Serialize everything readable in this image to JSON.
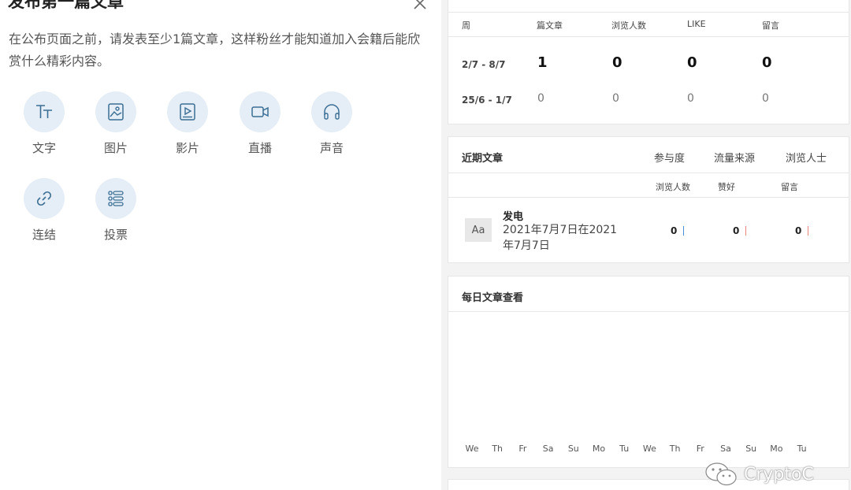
{
  "modal": {
    "title": "发布第一篇文章",
    "description": "在公布页面之前，请发表至少1篇文章，这样粉丝才能知道加入会籍后能欣赏什么精彩内容。",
    "post_types": [
      {
        "label": "文字",
        "icon": "text-icon"
      },
      {
        "label": "图片",
        "icon": "image-icon"
      },
      {
        "label": "影片",
        "icon": "video-icon"
      },
      {
        "label": "直播",
        "icon": "livestream-icon"
      },
      {
        "label": "声音",
        "icon": "audio-icon"
      },
      {
        "label": "连结",
        "icon": "link-icon"
      },
      {
        "label": "投票",
        "icon": "poll-icon"
      }
    ]
  },
  "weekly_stats": {
    "headers": {
      "week": "周",
      "posts": "篇文章",
      "views": "浏览人数",
      "likes": "LIKE",
      "comments": "留言"
    },
    "rows": [
      {
        "week": "2/7 - 8/7",
        "posts": "1",
        "views": "0",
        "likes": "0",
        "comments": "0"
      },
      {
        "week": "25/6 - 1/7",
        "posts": "0",
        "views": "0",
        "likes": "0",
        "comments": "0"
      }
    ]
  },
  "recent_posts": {
    "title": "近期文章",
    "columns": [
      "参与度",
      "流量来源",
      "浏览人士"
    ],
    "sub_headers": [
      "浏览人数",
      "赞好",
      "留言"
    ],
    "thumb": "Aa",
    "article": {
      "title": "发电",
      "date": "2021年7月7日在2021年7月7日",
      "views": "0",
      "likes": "0",
      "comments": "0"
    },
    "bar_colors": {
      "views": "#4a90d9",
      "likes": "#e8857a",
      "comments": "#e8857a"
    }
  },
  "daily_views": {
    "title": "每日文章查看",
    "days": [
      "We",
      "Th",
      "Fr",
      "Sa",
      "Su",
      "Mo",
      "Tu",
      "We",
      "Th",
      "Fr",
      "Sa",
      "Su",
      "Mo",
      "Tu"
    ]
  },
  "watermark": {
    "text": "CryptoC"
  },
  "colors": {
    "icon_bg": "#e5eef6",
    "icon_stroke": "#3b6e94"
  }
}
